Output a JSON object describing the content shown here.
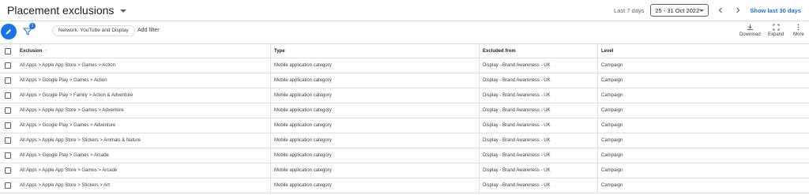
{
  "header": {
    "title": "Placement exclusions",
    "date_label": "Last 7 days",
    "date_range": "25 - 31 Oct 2022",
    "show_last": "Show last 30 days"
  },
  "toolbar": {
    "filter_badge": "1",
    "filter_chip": "Network: YouTube and Display",
    "add_filter": "Add filter",
    "download": "Download",
    "expand": "Expand",
    "more": "More"
  },
  "table": {
    "headers": {
      "exclusion": "Exclusion",
      "type": "Type",
      "excluded_from": "Excluded from",
      "level": "Level"
    },
    "rows": [
      {
        "exclusion": "All Apps > Apple App Store > Games > Action",
        "type": "Mobile application category",
        "excluded_from": "Display - Brand Awareness - UK",
        "level": "Campaign"
      },
      {
        "exclusion": "All Apps > Google Play > Games > Action",
        "type": "Mobile application category",
        "excluded_from": "Display - Brand Awareness - UK",
        "level": "Campaign"
      },
      {
        "exclusion": "All Apps > Google Play > Family > Action & Adventure",
        "type": "Mobile application category",
        "excluded_from": "Display - Brand Awareness - UK",
        "level": "Campaign"
      },
      {
        "exclusion": "All Apps > Apple App Store > Games > Adventure",
        "type": "Mobile application category",
        "excluded_from": "Display - Brand Awareness - UK",
        "level": "Campaign"
      },
      {
        "exclusion": "All Apps > Google Play > Games > Adventure",
        "type": "Mobile application category",
        "excluded_from": "Display - Brand Awareness - UK",
        "level": "Campaign"
      },
      {
        "exclusion": "All Apps > Apple App Store > Stickers > Animals & Nature",
        "type": "Mobile application category",
        "excluded_from": "Display - Brand Awareness - UK",
        "level": "Campaign"
      },
      {
        "exclusion": "All Apps > Google Play > Games > Arcade",
        "type": "Mobile application category",
        "excluded_from": "Display - Brand Awareness - UK",
        "level": "Campaign"
      },
      {
        "exclusion": "All Apps > Apple App Store > Games > Arcade",
        "type": "Mobile application category",
        "excluded_from": "Display - Brand Awareness - UK",
        "level": "Campaign"
      },
      {
        "exclusion": "All Apps > Apple App Store > Stickers > Art",
        "type": "Mobile application category",
        "excluded_from": "Display - Brand Awareness - UK",
        "level": "Campaign"
      }
    ]
  }
}
